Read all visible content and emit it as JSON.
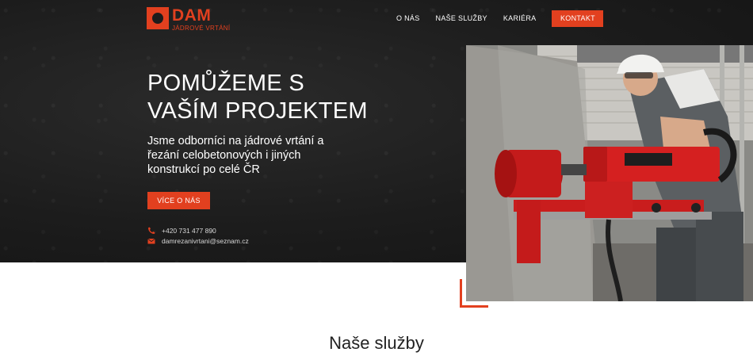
{
  "brand": {
    "name": "DAM",
    "subtitle": "JÁDROVÉ VRTÁNÍ",
    "accent_color": "#e2401f"
  },
  "nav": {
    "items": [
      "O NÁS",
      "NAŠE SLUŽBY",
      "KARIÉRA"
    ],
    "cta_label": "KONTAKT"
  },
  "hero": {
    "title_line1": "POMŮŽEME S",
    "title_line2": "VAŠÍM PROJEKTEM",
    "subtitle": "Jsme odborníci na jádrové vrtání a řezání celobetonových i jiných konstrukcí po celé ČR",
    "cta_label": "VÍCE O NÁS",
    "phone": "+420 731 477 890",
    "email": "damrezanivrtani@seznam.cz",
    "phone_icon": "phone-icon",
    "email_icon": "envelope-icon"
  },
  "services": {
    "title": "Naše služby"
  }
}
